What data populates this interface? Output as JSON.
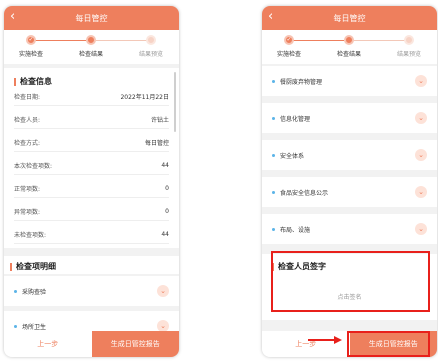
{
  "left": {
    "title": "每日管控",
    "back_icon": "chevron-left-icon",
    "steps": [
      {
        "label": "实施检查",
        "state": "done"
      },
      {
        "label": "检查结果",
        "state": "active"
      },
      {
        "label": "结果预览",
        "state": "pending"
      }
    ],
    "info": {
      "heading": "检查信息",
      "rows": [
        {
          "label": "检查日期:",
          "value": "2022年11月22日"
        },
        {
          "label": "检查人员:",
          "value": "许钻土"
        },
        {
          "label": "检查方式:",
          "value": "每日管控"
        },
        {
          "label": "本次检查项数:",
          "value": "44"
        },
        {
          "label": "正常项数:",
          "value": "0"
        },
        {
          "label": "异常项数:",
          "value": "0"
        },
        {
          "label": "未检查项数:",
          "value": "44"
        }
      ]
    },
    "details": {
      "heading": "检查项明细",
      "items": [
        "采购查验",
        "场所卫生"
      ]
    },
    "footer": {
      "prev": "上一步",
      "generate": "生成日管控报告"
    }
  },
  "right": {
    "title": "每日管控",
    "back_icon": "chevron-left-icon",
    "steps": [
      {
        "label": "实施检查",
        "state": "done"
      },
      {
        "label": "检查结果",
        "state": "active"
      },
      {
        "label": "结果预览",
        "state": "pending"
      }
    ],
    "items": [
      "餐厨废弃物管理",
      "信息化管理",
      "安全体系",
      "食品安全信息公示",
      "布局、设施"
    ],
    "signature": {
      "heading": "检查人员签字",
      "placeholder": "点击签名"
    },
    "footer": {
      "prev": "上一步",
      "generate": "生成日管控报告"
    }
  },
  "colors": {
    "accent": "#ee7f5d",
    "highlight": "#e8201b"
  }
}
